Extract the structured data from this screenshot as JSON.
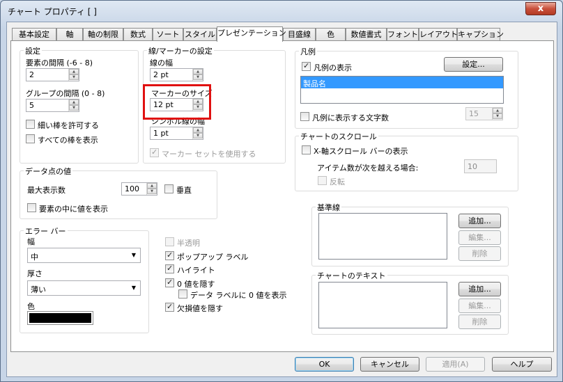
{
  "window": {
    "title": "チャート プロパティ [ ]",
    "close_label": "x"
  },
  "tabs": [
    "基本設定",
    "軸",
    "軸の制限",
    "数式",
    "ソート",
    "スタイル",
    "プレゼンテーション",
    "目盛線",
    "色",
    "数値書式",
    "フォント",
    "レイアウト",
    "キャプション"
  ],
  "settings": {
    "title": "設定",
    "element_spacing_label": "要素の間隔 (-6 - 8)",
    "element_spacing_value": "2",
    "group_spacing_label": "グループの間隔 (0 - 8)",
    "group_spacing_value": "5",
    "allow_thin_bars_label": "細い棒を許可する",
    "allow_thin_bars_checked": false,
    "show_all_bars_label": "すべての棒を表示",
    "show_all_bars_checked": false
  },
  "line_marker": {
    "title": "線/マーカーの設定",
    "line_width_label": "線の幅",
    "line_width_value": "2 pt",
    "marker_size_label": "マーカーのサイズ",
    "marker_size_value": "12 pt",
    "symbol_line_width_label": "シンボル線の幅",
    "symbol_line_width_value": "1 pt",
    "use_marker_set_label": "マーカー セットを使用する",
    "use_marker_set_checked": true
  },
  "data_point": {
    "title": "データ点の値",
    "max_display_label": "最大表示数",
    "max_display_value": "100",
    "vertical_label": "垂直",
    "vertical_checked": false,
    "show_inside_label": "要素の中に値を表示",
    "show_inside_checked": false
  },
  "error_bar": {
    "title": "エラー バー",
    "width_label": "幅",
    "width_value": "中",
    "thickness_label": "厚さ",
    "thickness_value": "薄い",
    "color_label": "色",
    "color": "#000000"
  },
  "options": {
    "semi_transparent_label": "半透明",
    "semi_transparent_checked": false,
    "popup_label": "ポップアップ ラベル",
    "popup_checked": true,
    "highlight_label": "ハイライト",
    "highlight_checked": true,
    "hide_zero_label": "0 値を隠す",
    "hide_zero_checked": true,
    "data_label_zero_label": "データ ラベルに 0 値を表示",
    "data_label_zero_checked": false,
    "hide_missing_label": "欠損値を隠す",
    "hide_missing_checked": true
  },
  "legend": {
    "title": "凡例",
    "show_label": "凡例の表示",
    "show_checked": true,
    "settings_button": "設定...",
    "items": [
      "製品名"
    ],
    "limit_chars_label": "凡例に表示する文字数",
    "limit_chars_checked": false,
    "limit_chars_value": "15"
  },
  "scroll": {
    "title": "チャートのスクロール",
    "x_scroll_label": "X-軸スクロール バーの表示",
    "x_scroll_checked": false,
    "item_count_label": "アイテム数が次を越える場合:",
    "item_count_value": "10",
    "reverse_label": "反転",
    "reverse_checked": false
  },
  "reference_lines": {
    "title": "基準線",
    "add": "追加...",
    "edit": "編集...",
    "delete": "削除"
  },
  "chart_text": {
    "title": "チャートのテキスト",
    "add": "追加...",
    "edit": "編集...",
    "delete": "削除"
  },
  "footer": {
    "ok": "OK",
    "cancel": "キャンセル",
    "apply": "適用(A)",
    "help": "ヘルプ"
  },
  "highlight_color": "#e01010",
  "accent_color": "#3399ff"
}
